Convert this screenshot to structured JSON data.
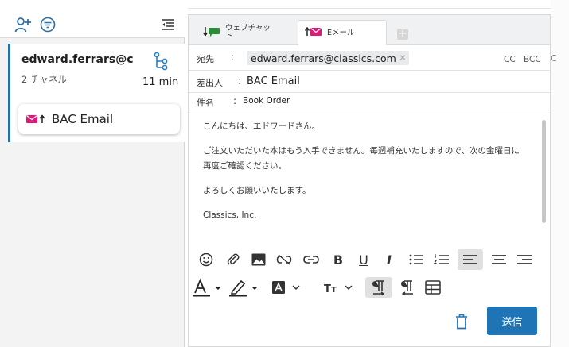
{
  "colors": {
    "accent_blue": "#1f74b6",
    "magenta": "#e0187a",
    "green": "#2e8b3a",
    "teal": "#2a7fbf"
  },
  "left_toolbar": {
    "add_contact_icon": "person-add-icon",
    "filter_icon": "filter-icon",
    "collapse_icon": "list-collapse-icon"
  },
  "conversation": {
    "email": "edward.ferrars@cl...",
    "channels": "2 チャネル",
    "time": "11 min",
    "channel_item": "BAC Email"
  },
  "tabs": [
    {
      "label": "ウェブチャット",
      "icon": "chat-icon"
    },
    {
      "label": "Eメール",
      "icon": "email-icon"
    }
  ],
  "fields": {
    "to_label": "宛先",
    "to_value": "edward.ferrars@classics.com",
    "cc": "CC",
    "bcc": "BCC",
    "from_label": "差出人",
    "from_value": "BAC Email",
    "subject_label": "件名",
    "subject_value": "Book Order"
  },
  "body": {
    "line1": "こんにちは、エドワードさん。",
    "line2": "ご注文いただいた本はもう入手できません。毎週補充いたしますので、次の金曜日に再度ご確認ください。",
    "line3": "よろしくお願いいたします。",
    "line4": "Classics, Inc."
  },
  "actions": {
    "send": "送信"
  },
  "edge_text": "C"
}
